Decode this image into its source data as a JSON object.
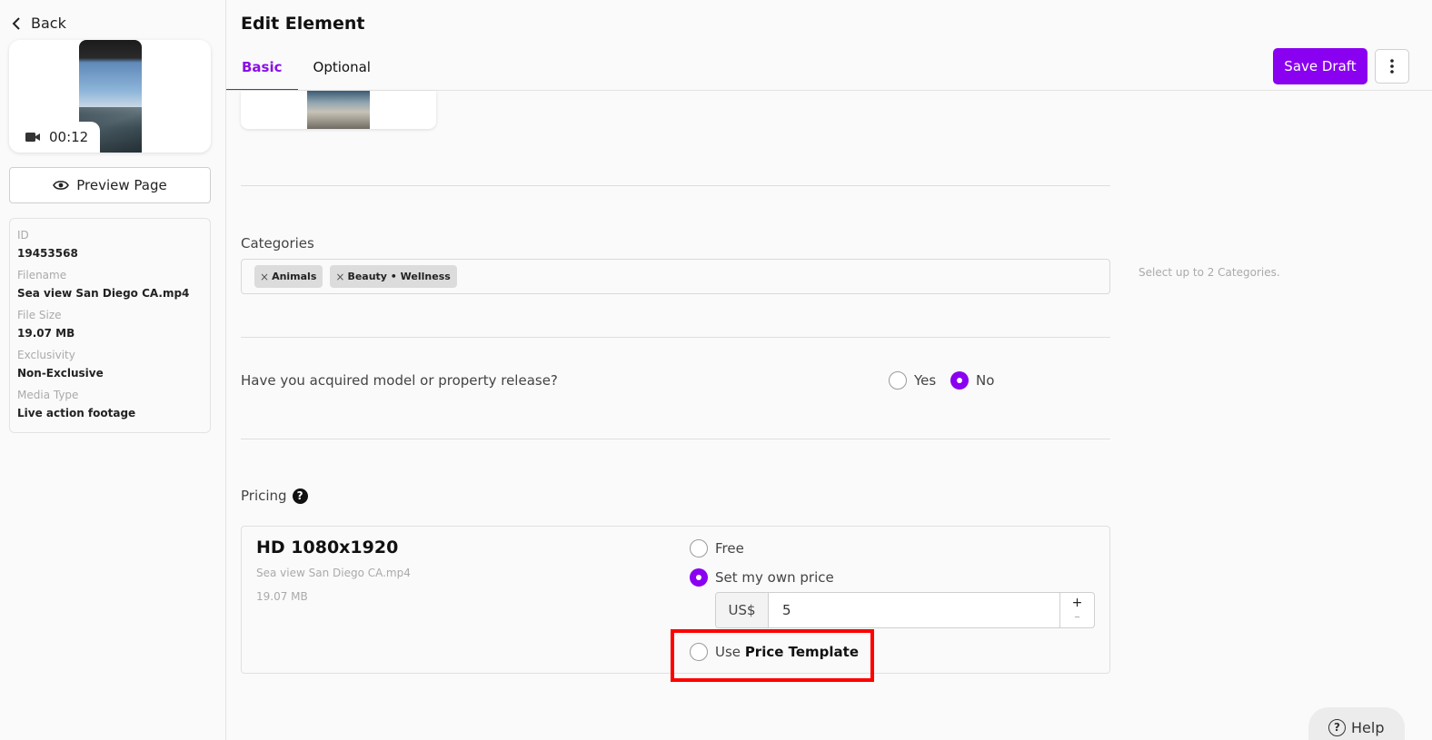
{
  "sidebar": {
    "back_label": "Back",
    "duration": "00:12",
    "preview_label": "Preview Page",
    "info": [
      {
        "label": "ID",
        "value": "19453568"
      },
      {
        "label": "Filename",
        "value": "Sea view San Diego CA.mp4"
      },
      {
        "label": "File Size",
        "value": "19.07 MB"
      },
      {
        "label": "Exclusivity",
        "value": "Non-Exclusive"
      },
      {
        "label": "Media Type",
        "value": "Live action footage"
      }
    ]
  },
  "header": {
    "title": "Edit Element",
    "tabs": [
      {
        "label": "Basic",
        "active": true
      },
      {
        "label": "Optional",
        "active": false
      }
    ],
    "save_label": "Save Draft",
    "more_icon": "more-vertical-icon"
  },
  "categories": {
    "label": "Categories",
    "chips": [
      "Animals",
      "Beauty • Wellness"
    ],
    "hint": "Select up to 2 Categories."
  },
  "release": {
    "question": "Have you acquired model or property release?",
    "options": [
      {
        "label": "Yes",
        "checked": false
      },
      {
        "label": "No",
        "checked": true
      }
    ]
  },
  "pricing": {
    "label": "Pricing",
    "resolution": "HD 1080x1920",
    "filename": "Sea view San Diego CA.mp4",
    "size": "19.07 MB",
    "options": {
      "free": "Free",
      "own": "Set my own price",
      "template_prefix": "Use",
      "template_bold": "Price Template"
    },
    "selected": "own",
    "currency": "US$",
    "amount": "5",
    "plus": "+",
    "minus": "–"
  },
  "help": {
    "label": "Help"
  },
  "colors": {
    "accent": "#8a00f0",
    "highlight": "#ff0000"
  }
}
